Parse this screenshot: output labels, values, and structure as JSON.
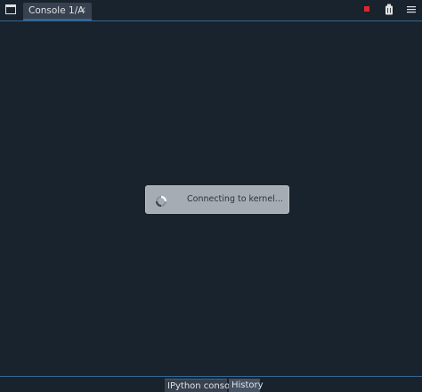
{
  "console_tab": {
    "label": "Console 1/A",
    "close_glyph": "×"
  },
  "icons": {
    "browse_tabs": "browse-tabs-icon",
    "interrupt": "stop-icon",
    "clear": "clear-console-icon",
    "options": "options-menu-icon"
  },
  "dialog": {
    "text": "Connecting to kernel..."
  },
  "bottom_tabs": [
    {
      "label": "IPython console"
    },
    {
      "label": "History"
    }
  ],
  "colors": {
    "background": "#19232d",
    "accent": "#346792",
    "stop": "#e0252c"
  }
}
